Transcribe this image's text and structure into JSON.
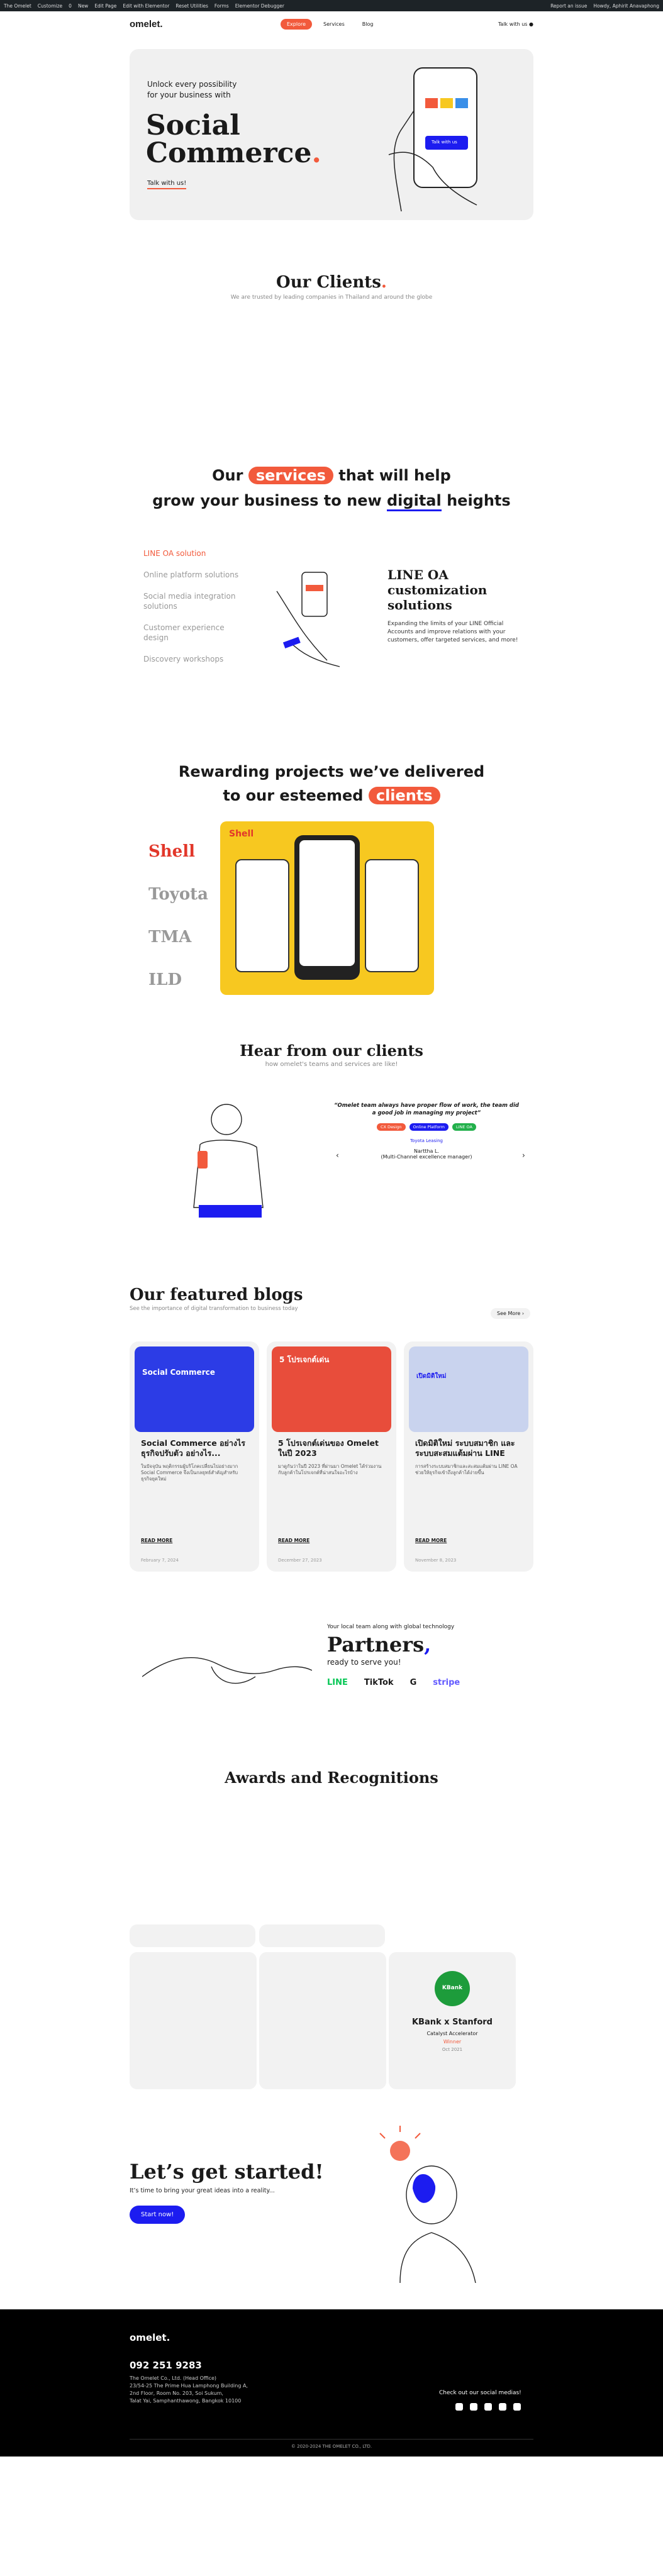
{
  "admin_bar": {
    "items": [
      "The Omelet",
      "Customize",
      "0",
      "New",
      "Edit Page",
      "Edit with Elementor",
      "Reset Utilities",
      "Forms",
      "Elementor Debugger"
    ],
    "right": [
      "Report an issue",
      "Howdy, Aphirit Anavaphong"
    ]
  },
  "header": {
    "logo": "omelet.",
    "nav": [
      "Explore",
      "Services",
      "Blog"
    ],
    "lang": "Talk with us ●"
  },
  "hero": {
    "subtitle_line1": "Unlock every possibility",
    "subtitle_line2": "for your business with",
    "title_line1": "Social",
    "title_line2": "Commerce",
    "title_dot": ".",
    "cta": "Talk with us!",
    "phone_btn": "Talk with us"
  },
  "clients": {
    "title": "Our Clients",
    "dot": ".",
    "subtitle": "We are trusted by leading companies in Thailand and around the globe"
  },
  "services": {
    "title_a": "Our",
    "title_pill": "services",
    "title_b": "that will help",
    "title_line2a": "grow your business to new",
    "title_line2_u": "digital",
    "title_line2b": "heights",
    "list": [
      "LINE OA solution",
      "Online platform solutions",
      "Social media integration solutions",
      "Customer experience design",
      "Discovery workshops"
    ],
    "detail_title": "LINE OA customization solutions",
    "detail_body": "Expanding the limits of your LINE Official Accounts and improve relations with your customers, offer targeted services, and more!"
  },
  "projects": {
    "title_line1": "Rewarding projects we’ve delivered",
    "title_line2a": "to our esteemed",
    "title_pill": "clients",
    "clients": [
      "Shell",
      "Toyota",
      "TMA",
      "ILD"
    ],
    "card_brand": "Shell"
  },
  "testimonials": {
    "title": "Hear from our clients",
    "subtitle": "how omelet's teams and services are like!",
    "quote": "“Omelet team always have proper flow of work, the team did a good job in managing my project”",
    "tags": [
      "CX Design",
      "Online Platform",
      "LINE OA"
    ],
    "company": "Toyota Leasing",
    "person": "Narttha L.",
    "role": "(Multi-Channel excellence manager)"
  },
  "blogs": {
    "title": "Our featured blogs",
    "subtitle": "See the importance of digital transformation to business today",
    "see_more": "See More ›",
    "items": [
      {
        "title": "Social Commerce อย่างไร ธุรกิจปรับตัว อย่างไร...",
        "excerpt": "ในปัจจุบัน พฤติกรรมผู้บริโภคเปลี่ยนไปอย่างมาก Social Commerce จึงเป็นกลยุทธ์สำคัญสำหรับธุรกิจยุคใหม่",
        "read": "READ MORE",
        "date": "February 7, 2024",
        "img_title": "Social Commerce"
      },
      {
        "title": "5 โปรเจกต์เด่นของ Omelet ในปี 2023",
        "excerpt": "มาดูกันว่าในปี 2023 ที่ผ่านมา Omelet ได้ร่วมงานกับลูกค้าในโปรเจกต์ที่น่าสนใจอะไรบ้าง",
        "read": "READ MORE",
        "date": "December 27, 2023",
        "img_title": "5 โปรเจกต์เด่น"
      },
      {
        "title": "เปิดมิติใหม่ ระบบสมาชิก และ ระบบสะสมแต้มผ่าน LINE",
        "excerpt": "การสร้างระบบสมาชิกและสะสมแต้มผ่าน LINE OA ช่วยให้ธุรกิจเข้าถึงลูกค้าได้ง่ายขึ้น",
        "read": "READ MORE",
        "date": "November 8, 2023",
        "img_title": "เปิดมิติใหม่"
      }
    ]
  },
  "partners": {
    "kicker": "Your local team along with global technology",
    "title": "Partners",
    "comma": ",",
    "tagline": "ready to serve you!",
    "logos": [
      "LINE",
      "TikTok",
      "G",
      "stripe"
    ]
  },
  "awards": {
    "title": "Awards and Recognitions",
    "featured_title": "KBank x Stanford",
    "featured_sub": "Catalyst Accelerator",
    "featured_status": "Winner",
    "featured_year": "Oct 2021",
    "badge": "KBank"
  },
  "cta": {
    "title": "Let’s get started!",
    "subtitle": "It’s time to bring your great ideas into a reality...",
    "button": "Start now!"
  },
  "footer": {
    "logo": "omelet.",
    "phone": "092 251 9283",
    "address": [
      "The Omelet Co., Ltd. (Head Office)",
      "23/54-25 The Prime Hua Lamphong Building A,",
      "2nd Floor, Room No. 203, Soi Sukum,",
      "Talat Yai, Samphanthawong, Bangkok 10100"
    ],
    "social_label": "Check out our social medias!",
    "copyright": "© 2020-2024 THE OMELET CO., LTD."
  },
  "colors": {
    "accent": "#f25a3c",
    "blue": "#1c1cf0",
    "yellow": "#f7c820"
  }
}
